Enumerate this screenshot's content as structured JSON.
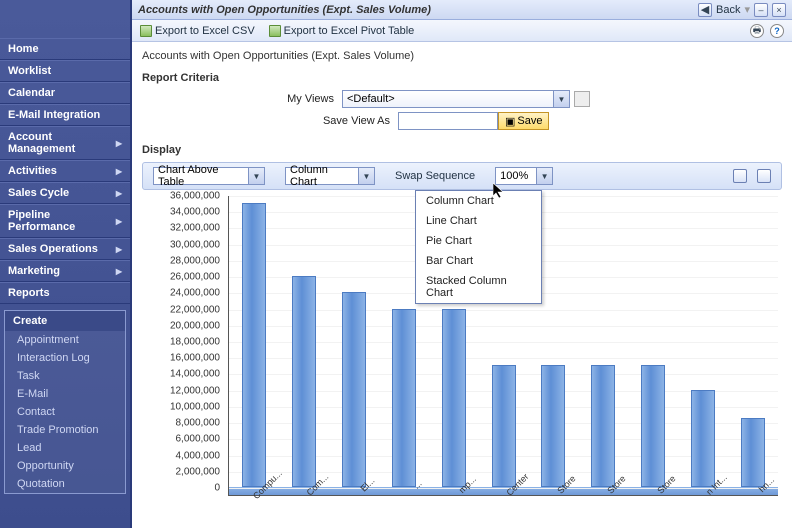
{
  "sidebar": {
    "items": [
      {
        "label": "Home",
        "expand": false
      },
      {
        "label": "Worklist",
        "expand": false
      },
      {
        "label": "Calendar",
        "expand": false
      },
      {
        "label": "E-Mail Integration",
        "expand": false
      },
      {
        "label": "Account Management",
        "expand": true
      },
      {
        "label": "Activities",
        "expand": true
      },
      {
        "label": "Sales Cycle",
        "expand": true
      },
      {
        "label": "Pipeline Performance",
        "expand": true
      },
      {
        "label": "Sales Operations",
        "expand": true
      },
      {
        "label": "Marketing",
        "expand": true
      },
      {
        "label": "Reports",
        "expand": false
      }
    ],
    "create": {
      "header": "Create",
      "items": [
        "Appointment",
        "Interaction Log",
        "Task",
        "E-Mail",
        "Contact",
        "Trade Promotion",
        "Lead",
        "Opportunity",
        "Quotation"
      ]
    }
  },
  "titlebar": {
    "title": "Accounts with Open Opportunities (Expt. Sales Volume)",
    "back_label": "Back",
    "back_glyph": "◀"
  },
  "toolbar": {
    "export_csv": "Export to Excel CSV",
    "export_pivot": "Export to Excel Pivot Table",
    "print_glyph": "🖶",
    "help_glyph": "?"
  },
  "subtitle": "Accounts with Open Opportunities (Expt. Sales Volume)",
  "sections": {
    "report_criteria": "Report Criteria",
    "display": "Display"
  },
  "criteria": {
    "my_views_label": "My Views",
    "my_views_value": "<Default>",
    "save_as_label": "Save View As",
    "save_as_value": "",
    "save_btn": "Save",
    "disk_glyph": "▣"
  },
  "display_bar": {
    "layout_value": "Chart Above Table",
    "chart_type_value": "Column Chart",
    "swap_label": "Swap Sequence",
    "zoom_value": "100%"
  },
  "chart_type_options": [
    "Column Chart",
    "Line Chart",
    "Pie Chart",
    "Bar Chart",
    "Stacked Column Chart"
  ],
  "chart_data": {
    "type": "bar",
    "categories": [
      "Compu...",
      "Com...",
      "El...",
      "...",
      "mp...",
      "Center",
      "Store",
      "Store",
      "Store",
      "n Int...",
      "hn..."
    ],
    "values": [
      35000000,
      26000000,
      24000000,
      22000000,
      22000000,
      15000000,
      15000000,
      15000000,
      15000000,
      12000000,
      8500000
    ],
    "title": "",
    "xlabel": "",
    "ylabel": "",
    "ylim": [
      0,
      36000000
    ],
    "yticks": [
      0,
      2000000,
      4000000,
      6000000,
      8000000,
      10000000,
      12000000,
      14000000,
      16000000,
      18000000,
      20000000,
      22000000,
      24000000,
      26000000,
      28000000,
      30000000,
      32000000,
      34000000,
      36000000
    ]
  }
}
